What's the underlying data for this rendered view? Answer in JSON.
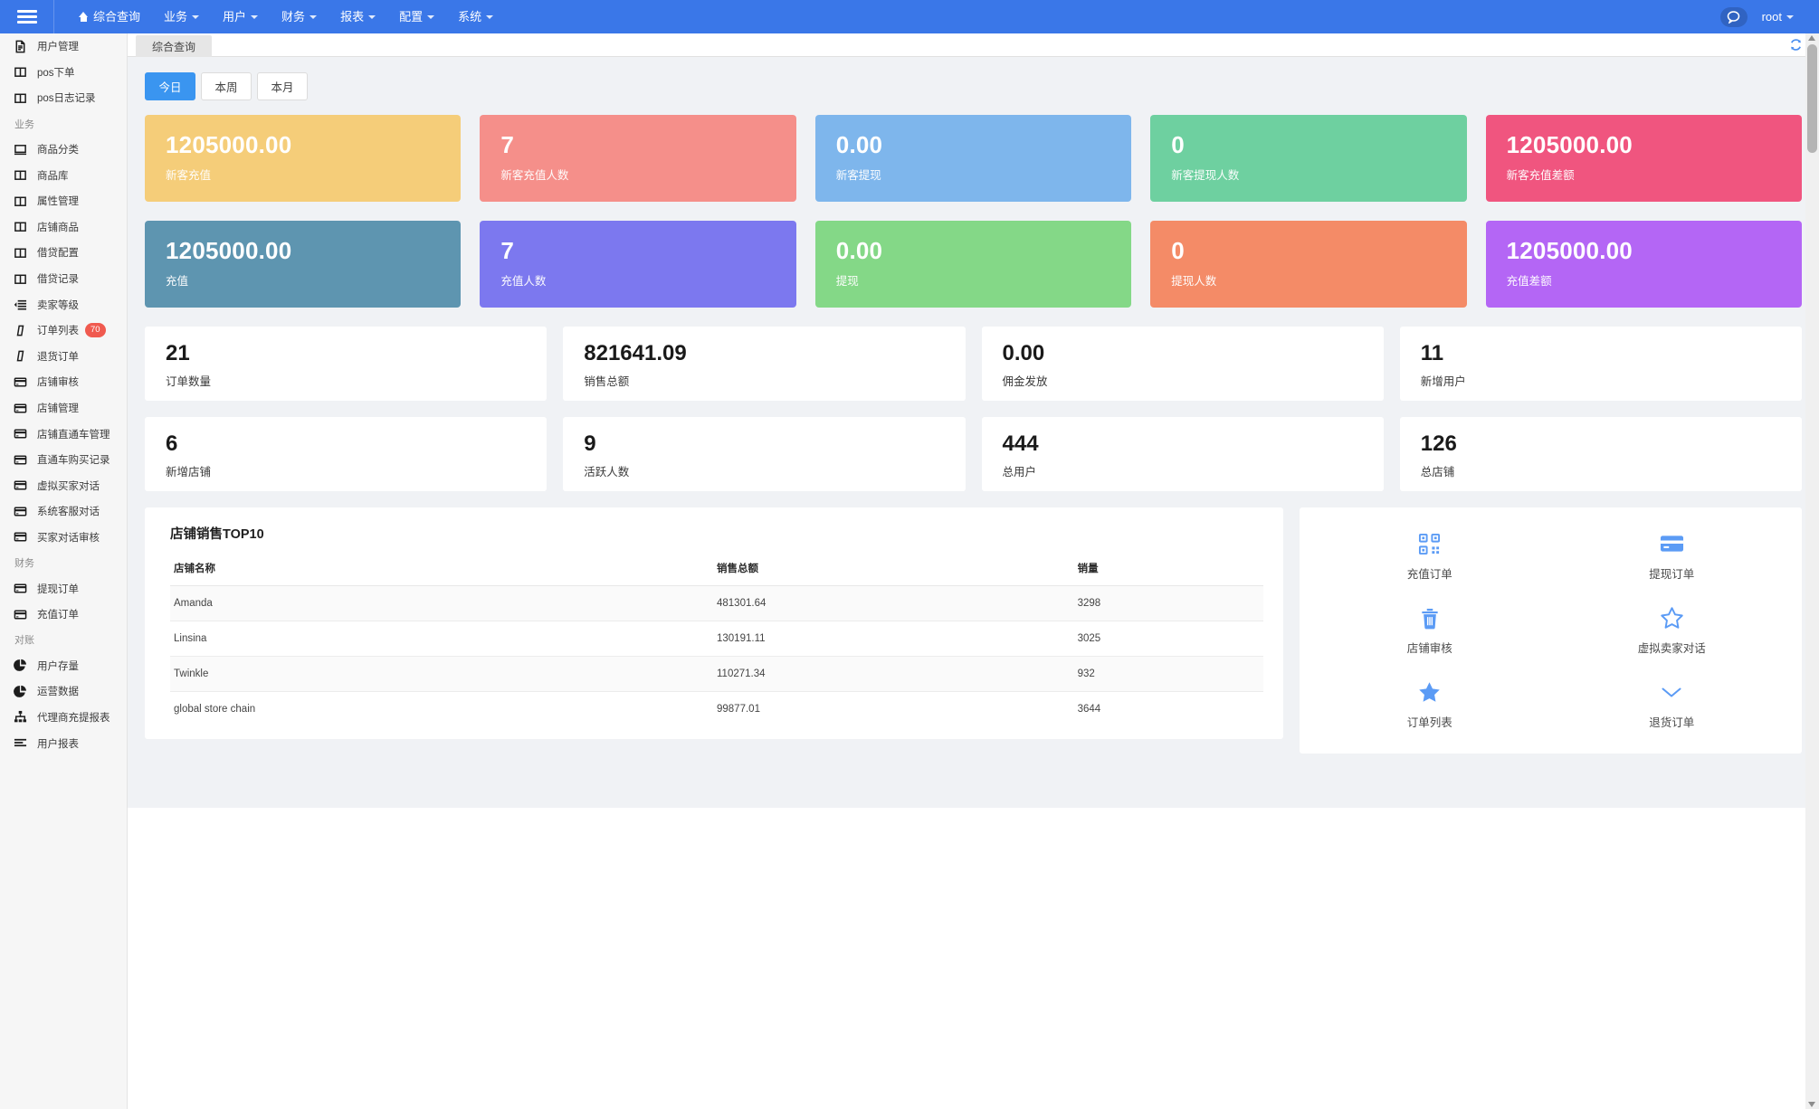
{
  "navbar": {
    "menu": [
      {
        "label": "综合查询",
        "icon": "home-icon",
        "has_caret": false
      },
      {
        "label": "业务",
        "icon": "",
        "has_caret": true
      },
      {
        "label": "用户",
        "icon": "",
        "has_caret": true
      },
      {
        "label": "财务",
        "icon": "",
        "has_caret": true
      },
      {
        "label": "报表",
        "icon": "",
        "has_caret": true
      },
      {
        "label": "配置",
        "icon": "",
        "has_caret": true
      },
      {
        "label": "系统",
        "icon": "",
        "has_caret": true
      }
    ],
    "chat_icon": "chat-bubble-icon",
    "user": "root",
    "hamburger_icon": "hamburger-icon"
  },
  "tabstrip": {
    "active_tab": "综合查询",
    "refresh_icon": "refresh-icon"
  },
  "sidebar": {
    "items": [
      {
        "label": "用户管理",
        "icon": "document-icon",
        "type": "item"
      },
      {
        "label": "pos下单",
        "icon": "columns-icon",
        "type": "item"
      },
      {
        "label": "pos日志记录",
        "icon": "columns-icon",
        "type": "item"
      },
      {
        "label": "业务",
        "icon": "",
        "type": "group"
      },
      {
        "label": "商品分类",
        "icon": "desktop-icon",
        "type": "item"
      },
      {
        "label": "商品库",
        "icon": "columns-icon",
        "type": "item"
      },
      {
        "label": "属性管理",
        "icon": "columns-icon",
        "type": "item"
      },
      {
        "label": "店铺商品",
        "icon": "columns-icon",
        "type": "item"
      },
      {
        "label": "借贷配置",
        "icon": "columns-icon",
        "type": "item"
      },
      {
        "label": "借贷记录",
        "icon": "columns-icon",
        "type": "item"
      },
      {
        "label": "卖家等级",
        "icon": "indent-list-icon",
        "type": "item"
      },
      {
        "label": "订单列表",
        "icon": "slash-icon",
        "type": "item",
        "badge": "70"
      },
      {
        "label": "退货订单",
        "icon": "slash-icon",
        "type": "item"
      },
      {
        "label": "店铺审核",
        "icon": "credit-card-icon",
        "type": "item"
      },
      {
        "label": "店铺管理",
        "icon": "credit-card-icon",
        "type": "item"
      },
      {
        "label": "店铺直通车管理",
        "icon": "credit-card-icon",
        "type": "item"
      },
      {
        "label": "直通车购买记录",
        "icon": "credit-card-icon",
        "type": "item"
      },
      {
        "label": "虚拟买家对话",
        "icon": "credit-card-icon",
        "type": "item"
      },
      {
        "label": "系统客服对话",
        "icon": "credit-card-icon",
        "type": "item"
      },
      {
        "label": "买家对话审核",
        "icon": "credit-card-icon",
        "type": "item"
      },
      {
        "label": "财务",
        "icon": "",
        "type": "group"
      },
      {
        "label": "提现订单",
        "icon": "credit-card-icon",
        "type": "item"
      },
      {
        "label": "充值订单",
        "icon": "credit-card-icon",
        "type": "item"
      },
      {
        "label": "对账",
        "icon": "",
        "type": "group"
      },
      {
        "label": "用户存量",
        "icon": "pie-chart-icon",
        "type": "item"
      },
      {
        "label": "运营数据",
        "icon": "pie-chart-icon",
        "type": "item"
      },
      {
        "label": "代理商充提报表",
        "icon": "sitemap-icon",
        "type": "item"
      },
      {
        "label": "用户报表",
        "icon": "list-icon",
        "type": "item"
      }
    ]
  },
  "main": {
    "period_buttons": [
      {
        "label": "今日",
        "active": true
      },
      {
        "label": "本周",
        "active": false
      },
      {
        "label": "本月",
        "active": false
      }
    ],
    "color_cards": [
      {
        "value": "1205000.00",
        "label": "新客充值",
        "color": "#f5cd79"
      },
      {
        "value": "7",
        "label": "新客充值人数",
        "color": "#f58f8a"
      },
      {
        "value": "0.00",
        "label": "新客提现",
        "color": "#7eb6ec"
      },
      {
        "value": "0",
        "label": "新客提现人数",
        "color": "#6ed0a0"
      },
      {
        "value": "1205000.00",
        "label": "新客充值差额",
        "color": "#f0557f"
      },
      {
        "value": "1205000.00",
        "label": "充值",
        "color": "#5e95b0"
      },
      {
        "value": "7",
        "label": "充值人数",
        "color": "#7c78ef"
      },
      {
        "value": "0.00",
        "label": "提现",
        "color": "#84d887"
      },
      {
        "value": "0",
        "label": "提现人数",
        "color": "#f48b67"
      },
      {
        "value": "1205000.00",
        "label": "充值差额",
        "color": "#b466f5"
      }
    ],
    "white_cards": [
      {
        "value": "21",
        "label": "订单数量"
      },
      {
        "value": "821641.09",
        "label": "销售总额"
      },
      {
        "value": "0.00",
        "label": "佣金发放"
      },
      {
        "value": "11",
        "label": "新增用户"
      },
      {
        "value": "6",
        "label": "新增店铺"
      },
      {
        "value": "9",
        "label": "活跃人数"
      },
      {
        "value": "444",
        "label": "总用户"
      },
      {
        "value": "126",
        "label": "总店铺"
      }
    ],
    "top10": {
      "title": "店铺销售TOP10",
      "columns": [
        "店铺名称",
        "销售总额",
        "销量"
      ],
      "rows": [
        {
          "name": "Amanda",
          "amount": "481301.64",
          "qty": "3298"
        },
        {
          "name": "Linsina",
          "amount": "130191.11",
          "qty": "3025"
        },
        {
          "name": "Twinkle",
          "amount": "110271.34",
          "qty": "932"
        },
        {
          "name": "global store chain",
          "amount": "99877.01",
          "qty": "3644"
        }
      ]
    },
    "quick_actions": [
      {
        "label": "充值订单",
        "icon": "qrcode-icon"
      },
      {
        "label": "提现订单",
        "icon": "credit-card-icon"
      },
      {
        "label": "店铺审核",
        "icon": "trash-icon"
      },
      {
        "label": "虚拟卖家对话",
        "icon": "star-outline-icon"
      },
      {
        "label": "订单列表",
        "icon": "star-filled-icon"
      },
      {
        "label": "退货订单",
        "icon": "chevron-down-icon"
      }
    ]
  },
  "colors": {
    "navbar": "#3a77e8",
    "accent": "#3a95f0",
    "badge": "#f05a4f",
    "quick_icon": "#5b9bf5",
    "content_bg": "#f0f2f5"
  }
}
